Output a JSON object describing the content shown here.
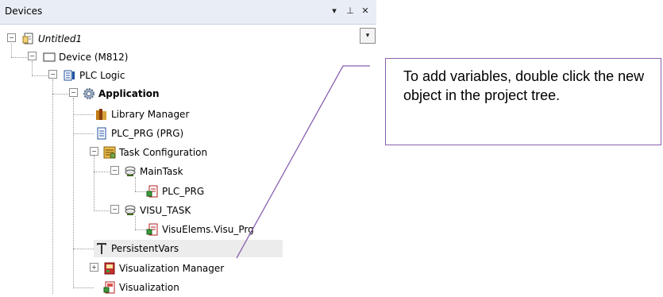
{
  "panel": {
    "title": "Devices",
    "buttons": {
      "dropdown": "▾",
      "pin": "⊥",
      "close": "✕"
    },
    "dropdown_glyph": "▾"
  },
  "tree": [
    {
      "id": "untitled1",
      "label": "Untitled1",
      "icon": "project-icon",
      "expander": "minus"
    },
    {
      "id": "device",
      "label": "Device (M812)",
      "icon": "device-icon",
      "expander": "minus"
    },
    {
      "id": "plc-logic",
      "label": "PLC Logic",
      "icon": "plc-logic-icon",
      "expander": "minus"
    },
    {
      "id": "application",
      "label": "Application",
      "icon": "application-gear-icon",
      "expander": "minus"
    },
    {
      "id": "library-manager",
      "label": "Library Manager",
      "icon": "library-books-icon"
    },
    {
      "id": "plc-prg",
      "label": "PLC_PRG (PRG)",
      "icon": "program-icon"
    },
    {
      "id": "task-configuration",
      "label": "Task Configuration",
      "icon": "task-configuration-icon",
      "expander": "minus"
    },
    {
      "id": "maintask",
      "label": "MainTask",
      "icon": "task-icon",
      "expander": "minus"
    },
    {
      "id": "maintask-plc-prg",
      "label": "PLC_PRG",
      "icon": "program-call-icon"
    },
    {
      "id": "visu-task",
      "label": "VISU_TASK",
      "icon": "task-icon",
      "expander": "minus"
    },
    {
      "id": "visuelems",
      "label": "VisuElems.Visu_Prg",
      "icon": "program-call-icon"
    },
    {
      "id": "persistentvars",
      "label": "PersistentVars",
      "icon": "persistent-vars-icon"
    },
    {
      "id": "visualization-manager",
      "label": "Visualization Manager",
      "icon": "visualization-manager-icon",
      "expander": "plus"
    },
    {
      "id": "visualization",
      "label": "Visualization",
      "icon": "visualization-icon"
    }
  ],
  "callout": {
    "text": "To add variables, double click the new object in the project tree.",
    "border_color": "#8a60b0"
  }
}
